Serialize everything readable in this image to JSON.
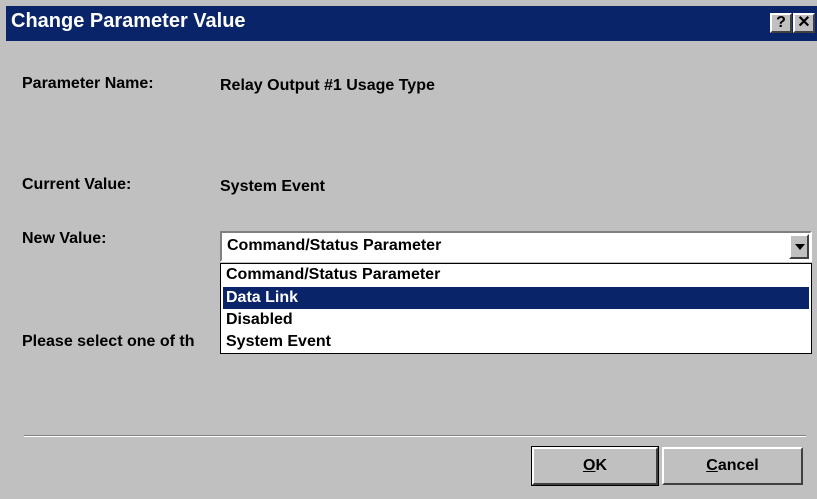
{
  "dialog": {
    "title": "Change Parameter Value",
    "help_button": "?",
    "close_button": "✕"
  },
  "fields": {
    "parameter_name_label": "Parameter Name:",
    "parameter_name_value": "Relay Output #1 Usage Type",
    "current_value_label": "Current Value:",
    "current_value": "System Event",
    "new_value_label": "New Value:",
    "new_value_selected": "Command/Status Parameter"
  },
  "dropdown": {
    "options": [
      "Command/Status Parameter",
      "Data Link",
      "Disabled",
      "System Event"
    ],
    "highlighted_option": "Data Link"
  },
  "instruction_text": "Please select one of th",
  "buttons": {
    "ok_mnemonic": "O",
    "ok_rest": "K",
    "cancel_mnemonic": "C",
    "cancel_rest": "ancel"
  },
  "colors": {
    "titlebar": "#0a246a",
    "dialog_bg": "#c0c0c0",
    "selection": "#0a246a"
  }
}
